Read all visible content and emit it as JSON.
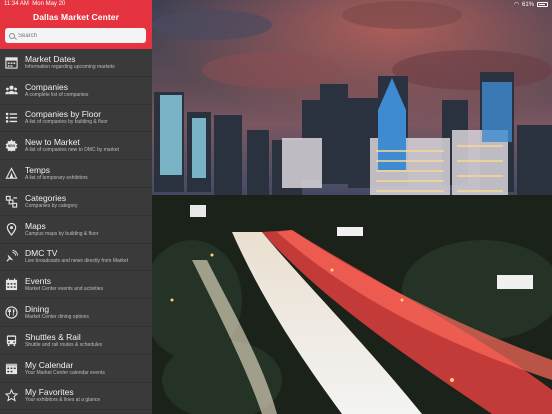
{
  "status_bar": {
    "time": "11:34 AM",
    "date": "Mon May 20",
    "battery_text": "61%"
  },
  "app": {
    "title": "Dallas Market Center"
  },
  "search": {
    "placeholder": "Search"
  },
  "menu": [
    {
      "title": "Market Dates",
      "subtitle": "Information regarding upcoming markets",
      "icon": "calendar-icon"
    },
    {
      "title": "Companies",
      "subtitle": "A complete list of companies",
      "icon": "people-icon"
    },
    {
      "title": "Companies by Floor",
      "subtitle": "A list of companies by building & floor",
      "icon": "list-icon"
    },
    {
      "title": "New to Market",
      "subtitle": "A list of companies new to DMC by market",
      "icon": "new-badge-icon"
    },
    {
      "title": "Temps",
      "subtitle": "A list of temporary exhibitors",
      "icon": "tent-icon"
    },
    {
      "title": "Categories",
      "subtitle": "Companies by category",
      "icon": "categories-icon"
    },
    {
      "title": "Maps",
      "subtitle": "Campus maps by building & floor",
      "icon": "map-pin-icon"
    },
    {
      "title": "DMC TV",
      "subtitle": "Live broadcasts and news directly from Market",
      "icon": "satellite-icon"
    },
    {
      "title": "Events",
      "subtitle": "Market Center events and activities",
      "icon": "events-calendar-icon"
    },
    {
      "title": "Dining",
      "subtitle": "Market Center dining options",
      "icon": "dining-icon"
    },
    {
      "title": "Shuttles & Rail",
      "subtitle": "Shuttle and rail routes & schedules",
      "icon": "bus-icon"
    },
    {
      "title": "My Calendar",
      "subtitle": "Your Market Center calendar events",
      "icon": "my-calendar-icon"
    },
    {
      "title": "My Favorites",
      "subtitle": "Your exhibitors & lines at a glance",
      "icon": "star-icon"
    }
  ],
  "colors": {
    "header_red": "#e5333f",
    "sidebar_bg": "#3a3a3a"
  }
}
